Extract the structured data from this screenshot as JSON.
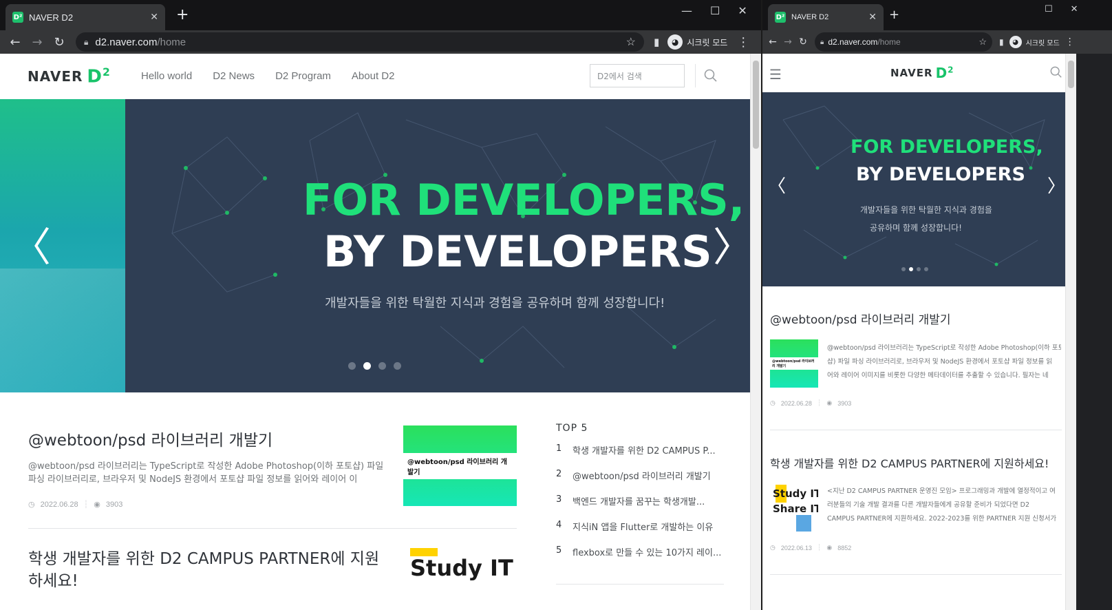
{
  "left": {
    "tab": {
      "favicon": "D²",
      "title": "NAVER D2",
      "close": "✕"
    },
    "newtab": "+",
    "window_controls": [
      "—",
      "☐",
      "✕"
    ],
    "url": {
      "host": "d2.naver.com",
      "path": "/home"
    },
    "incognito_label": "시크릿 모드",
    "logo": {
      "text": "NAVER",
      "mark": "D",
      "sup": "2"
    },
    "nav": [
      "Hello world",
      "D2 News",
      "D2 Program",
      "About D2"
    ],
    "search_placeholder": "D2에서 검색",
    "hero": {
      "line1": "FOR DEVELOPERS,",
      "line2": "BY DEVELOPERS",
      "sub": "개발자들을 위한 탁월한 지식과 경험을 공유하며 함께 성장합니다!",
      "prev": "〈",
      "next": "〉",
      "slide_count": 4,
      "active_slide": 2
    },
    "posts": [
      {
        "title": "@webtoon/psd 라이브러리 개발기",
        "desc1": "@webtoon/psd 라이브러리는 TypeScript로 작성한 Adobe Photoshop(이하 포토샵) 파일",
        "desc2": "파싱 라이브러리로, 브라우저 및 NodeJS 환경에서 포토샵 파일 정보를 읽어와 레이어 이",
        "date": "2022.06.28",
        "views": "3903",
        "thumb_text": "@webtoon/psd 라이브러리 개발기"
      },
      {
        "title1": "학생 개발자를 위한 D2 CAMPUS PARTNER에 지원",
        "title2": "하세요!",
        "thumb_line1": "Study IT"
      }
    ],
    "top5": {
      "title": "TOP 5",
      "items": [
        {
          "num": "1",
          "text": "학생 개발자를 위한 D2 CAMPUS P..."
        },
        {
          "num": "2",
          "text": "@webtoon/psd 라이브러리 개발기"
        },
        {
          "num": "3",
          "text": "백엔드 개발자를 꿈꾸는 학생개발..."
        },
        {
          "num": "4",
          "text": "지식iN 앱을 Flutter로 개발하는 이유"
        },
        {
          "num": "5",
          "text": "flexbox로 만들 수 있는 10가지 레이..."
        }
      ]
    }
  },
  "right": {
    "tab": {
      "favicon": "D²",
      "title": "NAVER D2",
      "close": "✕"
    },
    "newtab": "+",
    "window_controls": [
      "☐",
      "✕"
    ],
    "url": {
      "host": "d2.naver.com",
      "path": "/home"
    },
    "incognito_label": "시크릿 모드",
    "menu_icon": "☰",
    "logo": {
      "text": "NAVER",
      "mark": "D",
      "sup": "2"
    },
    "hero": {
      "line1": "FOR DEVELOPERS,",
      "line2": "BY DEVELOPERS",
      "sub1": "개발자들을 위한 탁월한 지식과 경험을",
      "sub2": "공유하며 함께 성장합니다!",
      "prev": "〈",
      "next": "〉",
      "slide_count": 4,
      "active_slide": 2
    },
    "posts": [
      {
        "title": "@webtoon/psd 라이브러리 개발기",
        "desc1": "@webtoon/psd 라이브러리는 TypeScript로 작성한 Adobe Photoshop(이하 포토",
        "desc2": "샵) 파일 파싱 라이브러리로, 브라우저 및 NodeJS 환경에서 포토샵 파일 정보를 읽",
        "desc3": "어와 레이어 이미지를 비롯한 다양한 메타데이터를 추출할 수 있습니다. 필자는 네",
        "date": "2022.06.28",
        "views": "3903",
        "thumb_text": "@webtoon/psd 라이브러리 개발기"
      },
      {
        "title": "학생 개발자를 위한 D2 CAMPUS PARTNER에 지원하세요!",
        "desc1": "<지난 D2 CAMPUS PARTNER 운영진 모임> 프로그래밍과 개발에 열정적이고 여",
        "desc2": "러분들의 기술 개발 결과를 다른 개발자들에게 공유할 준비가 되었다면 D2",
        "desc3": "CAMPUS PARTNER에 지원하세요. 2022-2023를 위한 PARTNER 지원 신청서가",
        "date": "2022.06.13",
        "views": "8852",
        "thumb_line1": "Study IT",
        "thumb_line2": "Share IT"
      }
    ]
  },
  "colors": {
    "brand_green": "#19c36a",
    "hero_bg": "#2f3e54",
    "hero_green_text": "#1fe07a",
    "chrome_dark": "#202124"
  }
}
